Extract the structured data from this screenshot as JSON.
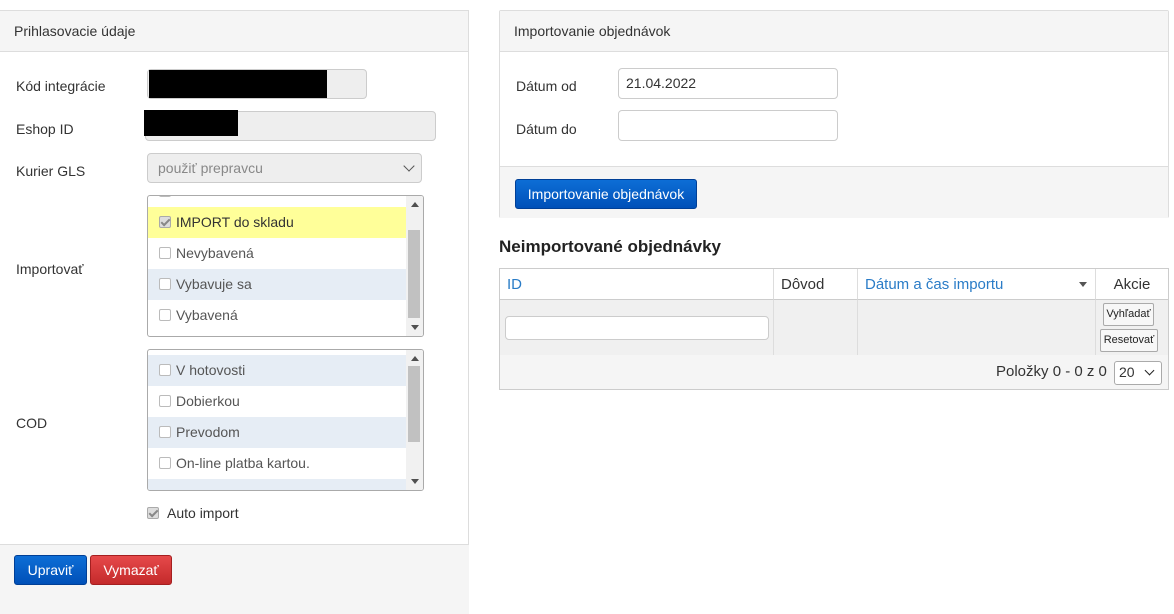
{
  "credentials": {
    "title": "Prihlasovacie údaje",
    "integration_code_label": "Kód integrácie",
    "eshop_id_label": "Eshop ID",
    "courier_label": "Kurier GLS",
    "courier_value": "použiť prepravcu",
    "import_label": "Importovať",
    "import_items": [
      {
        "label": "IMPORT do skladu",
        "checked": true
      },
      {
        "label": "Nevybavená",
        "checked": false
      },
      {
        "label": "Vybavuje sa",
        "checked": false
      },
      {
        "label": "Vybavená",
        "checked": false
      }
    ],
    "cod_label": "COD",
    "cod_items": [
      {
        "label": "V hotovosti",
        "checked": false
      },
      {
        "label": "Dobierkou",
        "checked": false
      },
      {
        "label": "Prevodom",
        "checked": false
      },
      {
        "label": "On-line platba kartou.",
        "checked": false
      }
    ],
    "auto_import_label": "Auto import",
    "edit_button": "Upraviť",
    "delete_button": "Vymazať"
  },
  "import_orders": {
    "title": "Importovanie objednávok",
    "date_from_label": "Dátum od",
    "date_from_value": "21.04.2022",
    "date_to_label": "Dátum do",
    "date_to_value": "",
    "import_button": "Importovanie objednávok"
  },
  "unimported": {
    "title": "Neimportované objednávky",
    "columns": {
      "id": "ID",
      "reason": "Dôvod",
      "datetime": "Dátum a čas importu",
      "actions": "Akcie"
    },
    "search_button": "Vyhľadať",
    "reset_button": "Resetovať",
    "pager_text": "Položky 0 - 0 z 0",
    "page_size": "20"
  }
}
